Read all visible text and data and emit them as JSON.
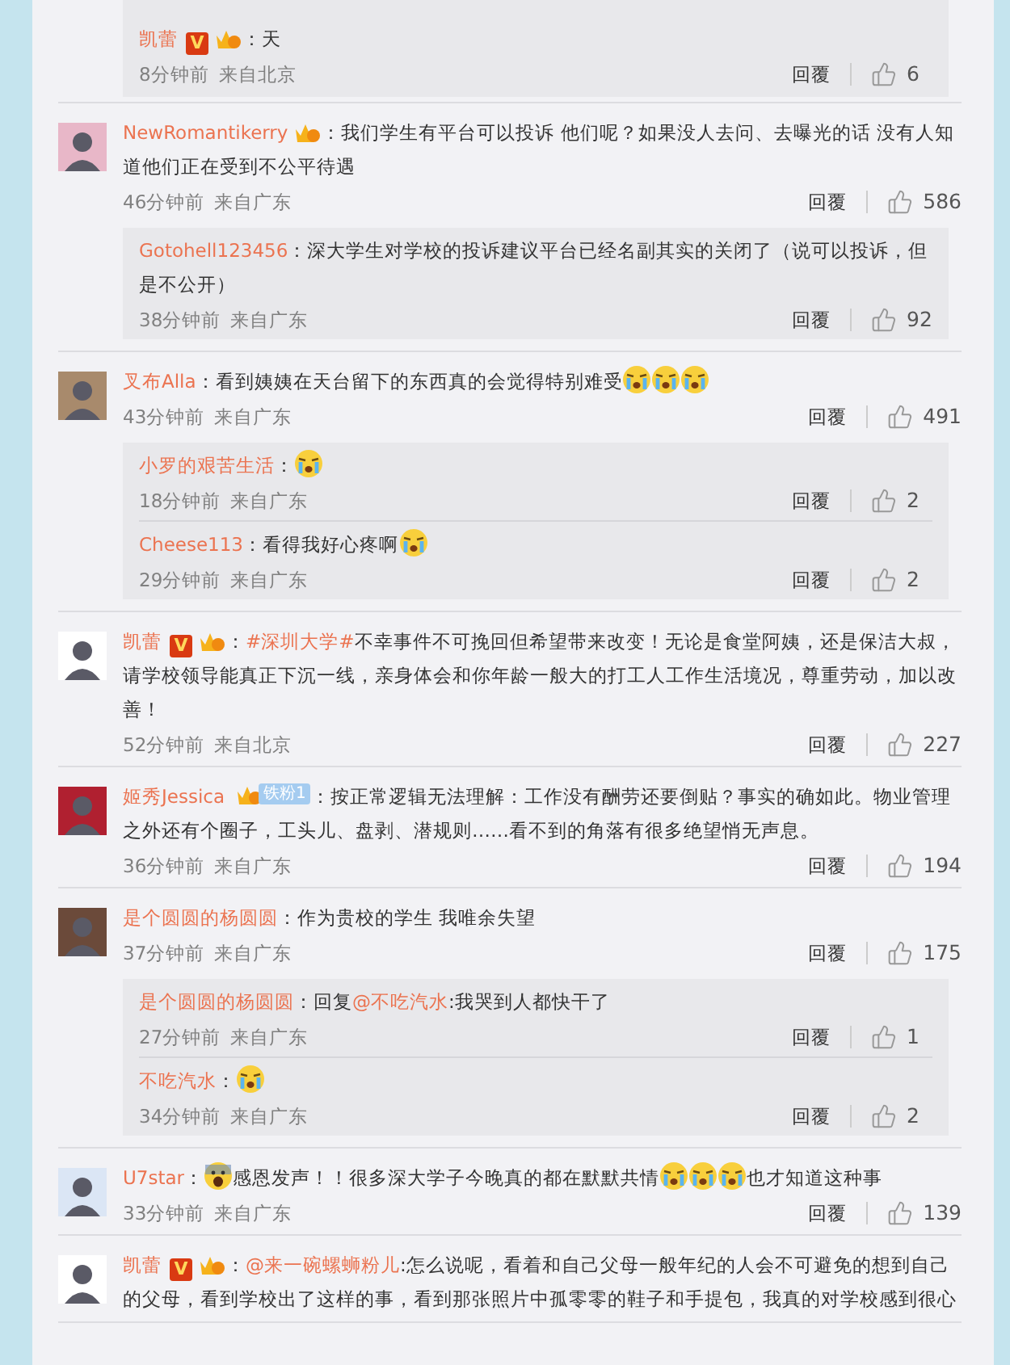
{
  "top_reply_box": {
    "replies": [
      {
        "user": "凯蕾",
        "badges": [
          {
            "kind": "verified",
            "text": "V"
          },
          {
            "kind": "crown"
          }
        ],
        "content": [
          {
            "kind": "text",
            "text": "：天"
          }
        ],
        "time": "8分钟前",
        "location": "来自北京",
        "reply": "回覆",
        "likes": "6"
      }
    ]
  },
  "comments": [
    {
      "user": "NewRomantikerry",
      "badges": [
        {
          "kind": "crown"
        }
      ],
      "content": [
        {
          "kind": "text",
          "text": "：我们学生有平台可以投诉 他们呢？如果没人去问、去曝光的话 没有人知道他们正在受到不公平待遇"
        }
      ],
      "time": "46分钟前",
      "location": "来自广东",
      "reply": "回覆",
      "likes": "586",
      "replies": [
        {
          "user": "Gotohell123456",
          "content": [
            {
              "kind": "text",
              "text": "：深大学生对学校的投诉建议平台已经名副其实的关闭了（说可以投诉，但是不公开）"
            }
          ],
          "time": "38分钟前",
          "location": "来自广东",
          "reply": "回覆",
          "likes": "92"
        }
      ]
    },
    {
      "user": "叉布Alla",
      "content": [
        {
          "kind": "text",
          "text": "：看到姨姨在天台留下的东西真的会觉得特别难受"
        },
        {
          "kind": "cry_emoji"
        },
        {
          "kind": "cry_emoji"
        },
        {
          "kind": "cry_emoji"
        }
      ],
      "time": "43分钟前",
      "location": "来自广东",
      "reply": "回覆",
      "likes": "491",
      "replies": [
        {
          "user": "小罗的艰苦生活",
          "content": [
            {
              "kind": "text",
              "text": "："
            },
            {
              "kind": "cry_emoji"
            }
          ],
          "time": "18分钟前",
          "location": "来自广东",
          "reply": "回覆",
          "likes": "2"
        },
        {
          "user": "Cheese113",
          "content": [
            {
              "kind": "text",
              "text": "：看得我好心疼啊"
            },
            {
              "kind": "cry_emoji"
            }
          ],
          "time": "29分钟前",
          "location": "来自广东",
          "reply": "回覆",
          "likes": "2"
        }
      ]
    },
    {
      "user": "凯蕾",
      "badges": [
        {
          "kind": "verified",
          "text": "V"
        },
        {
          "kind": "crown"
        }
      ],
      "content": [
        {
          "kind": "text",
          "text": "："
        },
        {
          "kind": "link",
          "text": "#深圳大学#"
        },
        {
          "kind": "text",
          "text": "不幸事件不可挽回但希望带来改变！无论是食堂阿姨，还是保洁大叔，请学校领导能真正下沉一线，亲身体会和你年龄一般大的打工人工作生活境况，尊重劳动，加以改善！"
        }
      ],
      "time": "52分钟前",
      "location": "来自北京",
      "reply": "回覆",
      "likes": "227"
    },
    {
      "user": "姬秀Jessica",
      "badges": [
        {
          "kind": "fan",
          "text": "铁粉1"
        }
      ],
      "content": [
        {
          "kind": "text",
          "text": "：按正常逻辑无法理解：工作没有酬劳还要倒贴？事实的确如此。物业管理之外还有个圈子，工头儿、盘剥、潜规则……看不到的角落有很多绝望悄无声息。"
        }
      ],
      "time": "36分钟前",
      "location": "来自广东",
      "reply": "回覆",
      "likes": "194"
    },
    {
      "user": "是个圆圆的杨圆圆",
      "content": [
        {
          "kind": "text",
          "text": "：作为贵校的学生 我唯余失望"
        }
      ],
      "time": "37分钟前",
      "location": "来自广东",
      "reply": "回覆",
      "likes": "175",
      "replies": [
        {
          "user": "是个圆圆的杨圆圆",
          "content": [
            {
              "kind": "text",
              "text": "：回复"
            },
            {
              "kind": "link",
              "text": "@不吃汽水"
            },
            {
              "kind": "text",
              "text": ":我哭到人都快干了"
            }
          ],
          "time": "27分钟前",
          "location": "来自广东",
          "reply": "回覆",
          "likes": "1"
        },
        {
          "user": "不吃汽水",
          "content": [
            {
              "kind": "text",
              "text": "："
            },
            {
              "kind": "cry_emoji"
            }
          ],
          "time": "34分钟前",
          "location": "来自广东",
          "reply": "回覆",
          "likes": "2"
        }
      ]
    },
    {
      "user": "U7star",
      "content": [
        {
          "kind": "text",
          "text": "："
        },
        {
          "kind": "scream_emoji"
        },
        {
          "kind": "text",
          "text": "感恩发声！！很多深大学子今晚真的都在默默共情"
        },
        {
          "kind": "cry_emoji"
        },
        {
          "kind": "cry_emoji"
        },
        {
          "kind": "cry_emoji"
        },
        {
          "kind": "text",
          "text": "也才知道这种事"
        }
      ],
      "time": "33分钟前",
      "location": "来自广东",
      "reply": "回覆",
      "likes": "139"
    },
    {
      "user": "凯蕾",
      "badges": [
        {
          "kind": "verified",
          "text": "V"
        },
        {
          "kind": "crown"
        }
      ],
      "content": [
        {
          "kind": "text",
          "text": "："
        },
        {
          "kind": "link",
          "text": "@来一碗螺蛳粉儿"
        },
        {
          "kind": "text",
          "text": ":怎么说呢，看着和自己父母一般年纪的人会不可避免的想到自己的父母，看到学校出了这样的事，看到那张照片中孤零零的鞋子和手提包，我真的对学校感到很心"
        }
      ]
    }
  ]
}
